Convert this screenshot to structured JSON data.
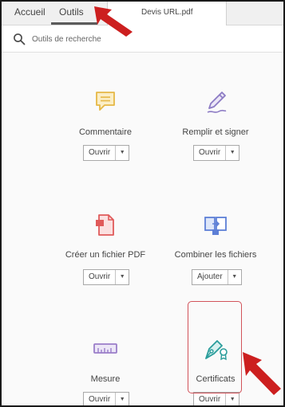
{
  "tabs": {
    "home": "Accueil",
    "tools": "Outils",
    "document": "Devis URL.pdf"
  },
  "search": {
    "placeholder": "Outils de recherche"
  },
  "tools": [
    {
      "label": "Commentaire",
      "button": "Ouvrir",
      "icon": "comment-icon",
      "color": "#e6b845"
    },
    {
      "label": "Remplir et signer",
      "button": "Ouvrir",
      "icon": "fill-sign-icon",
      "color": "#8c7bc4"
    },
    {
      "label": "Créer un fichier PDF",
      "button": "Ouvrir",
      "icon": "create-pdf-icon",
      "color": "#e05a5a"
    },
    {
      "label": "Combiner les fichiers",
      "button": "Ajouter",
      "icon": "combine-files-icon",
      "color": "#5d7fd6"
    },
    {
      "label": "Mesure",
      "button": "Ouvrir",
      "icon": "ruler-icon",
      "color": "#9a7dc9"
    },
    {
      "label": "Certificats",
      "button": "Ouvrir",
      "icon": "certificate-icon",
      "color": "#2a9d9b"
    }
  ],
  "dropdown_caret": "▼",
  "annotation_color": "#cc1f1f"
}
